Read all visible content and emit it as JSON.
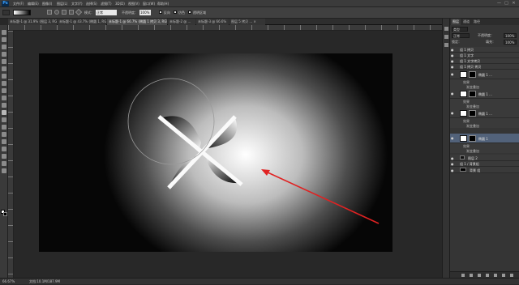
{
  "menu": {
    "app_logo": "Ps",
    "items": [
      "文件(F)",
      "编辑(E)",
      "图像(I)",
      "图层(L)",
      "文字(Y)",
      "选择(S)",
      "滤镜(T)",
      "3D(D)",
      "视图(V)",
      "窗口(W)",
      "帮助(H)"
    ],
    "window_controls": [
      "—",
      "□",
      "✕"
    ]
  },
  "options": {
    "mode_label": "模式：",
    "mode_value": "正常",
    "opacity_label": "不透明度：",
    "opacity_value": "100%",
    "reverse_label": "反向",
    "dither_label": "仿色",
    "transparency_label": "透明区域"
  },
  "tabs": [
    {
      "label": "未标题-1 @ 31.9% (图层 3, RGB/8#) ×",
      "active": false
    },
    {
      "label": "未标题-1 @ 43.7% (椭圆 1, RGB/8) ×",
      "active": false
    },
    {
      "label": "未标题-1 @ 66.7% (椭圆 1 拷贝 3, RGB/8) ×",
      "active": true
    },
    {
      "label": "未标题-2 @ ...",
      "active": false
    },
    {
      "label": "未标题-3 @ 66.6%",
      "active": false
    },
    {
      "label": "图层 5 拷贝 ... ×",
      "active": false
    }
  ],
  "status": {
    "zoom": "66.67%",
    "doc_info": "文档:10.1M/187.9M"
  },
  "layers_panel": {
    "tabs": [
      "图层",
      "通道",
      "路径"
    ],
    "filter_value": "类型",
    "blend_value": "正常",
    "opacity_label": "不透明度：",
    "opacity_value": "100%",
    "lock_label": "锁定：",
    "fill_label": "填充：",
    "fill_value": "100%",
    "rows": [
      {
        "name": "组 1 拷贝",
        "kind": "group",
        "selected": false
      },
      {
        "name": "组 1 文字",
        "kind": "group",
        "selected": false
      },
      {
        "name": "组 1 文字拷贝",
        "kind": "group",
        "selected": false
      },
      {
        "name": "组 1 拷贝 拷贝",
        "kind": "group",
        "selected": false
      },
      {
        "name": "椭圆 1 ...",
        "kind": "layer",
        "selected": false
      },
      {
        "name": "效果",
        "kind": "fx",
        "selected": false
      },
      {
        "name": "渐变叠加",
        "kind": "fx",
        "selected": false
      },
      {
        "name": "椭圆 1 ...",
        "kind": "layer",
        "selected": false
      },
      {
        "name": "效果",
        "kind": "fx",
        "selected": false
      },
      {
        "name": "渐变叠加",
        "kind": "fx",
        "selected": false
      },
      {
        "name": "椭圆 1 ...",
        "kind": "layer",
        "selected": false
      },
      {
        "name": "效果",
        "kind": "fx",
        "selected": false
      },
      {
        "name": "渐变叠加",
        "kind": "fx",
        "selected": false
      },
      {
        "name": "椭圆 1",
        "kind": "layer",
        "selected": true
      },
      {
        "name": "效果",
        "kind": "fx",
        "selected": false
      },
      {
        "name": "渐变叠加",
        "kind": "fx",
        "selected": false
      },
      {
        "name": "图层 2",
        "kind": "small",
        "selected": false
      },
      {
        "name": "组 1 / 背景组",
        "kind": "group",
        "selected": false
      },
      {
        "name": "背景 组",
        "kind": "small",
        "selected": false
      }
    ]
  },
  "colors": {
    "highlight": "#e02222",
    "selected_layer": "#52627a"
  }
}
